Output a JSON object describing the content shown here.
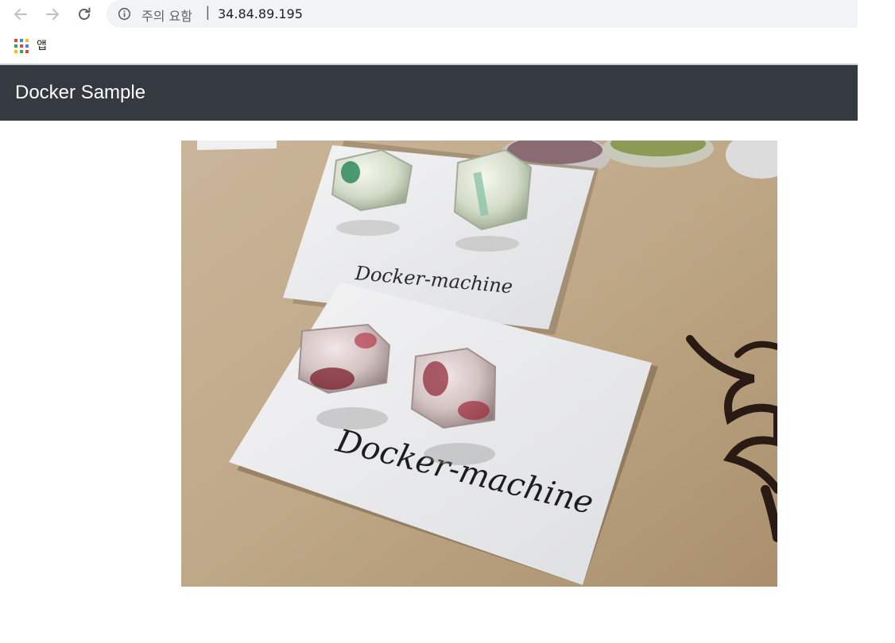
{
  "browser": {
    "back_icon": "arrow-left-icon",
    "forward_icon": "arrow-right-icon",
    "reload_icon": "reload-icon",
    "security_icon": "info-circle-icon",
    "security_warning": "주의 요함",
    "separator": "|",
    "url": "34.84.89.195",
    "bookmarks": {
      "apps_icon": "apps-grid-icon",
      "apps_label": "앱"
    }
  },
  "navbar": {
    "brand": "Docker Sample",
    "background": "#343a40"
  },
  "photo": {
    "card_back_text": "Docker-machine",
    "card_front_text": "Docker-machine"
  }
}
